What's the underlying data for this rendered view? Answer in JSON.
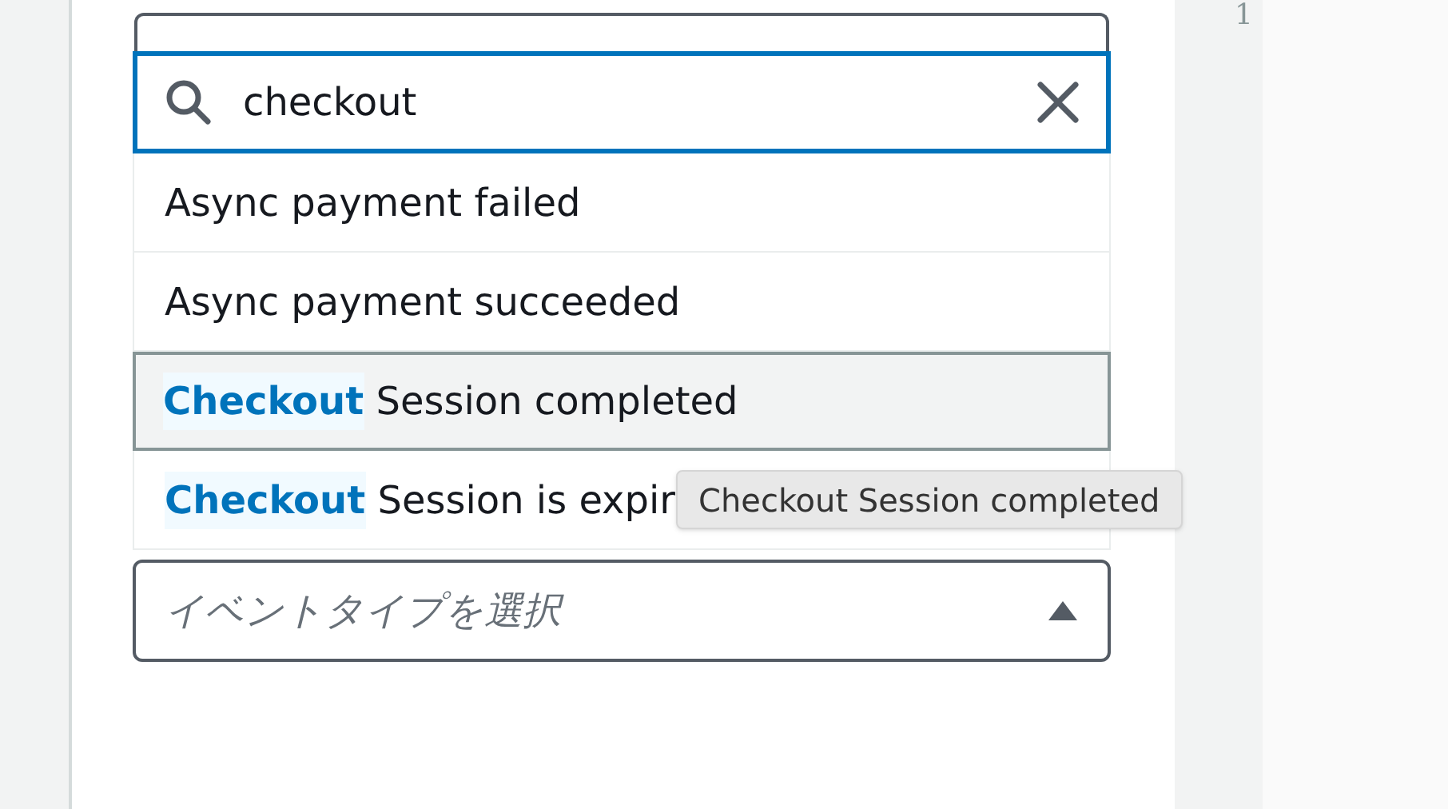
{
  "search": {
    "value": "checkout"
  },
  "options": [
    {
      "selected": false,
      "parts": [
        {
          "text": "Async payment failed",
          "match": false
        }
      ]
    },
    {
      "selected": false,
      "parts": [
        {
          "text": "Async payment succeeded",
          "match": false
        }
      ]
    },
    {
      "selected": true,
      "parts": [
        {
          "text": "Checkout",
          "match": true
        },
        {
          "text": " Session completed",
          "match": false
        }
      ]
    },
    {
      "selected": false,
      "parts": [
        {
          "text": "Checkout",
          "match": true
        },
        {
          "text": " Session is expir",
          "match": false
        }
      ]
    }
  ],
  "tooltip": "Checkout Session completed",
  "select": {
    "placeholder": "イベントタイプを選択",
    "expanded": true
  },
  "editor": {
    "line_numbers": [
      "1"
    ]
  }
}
